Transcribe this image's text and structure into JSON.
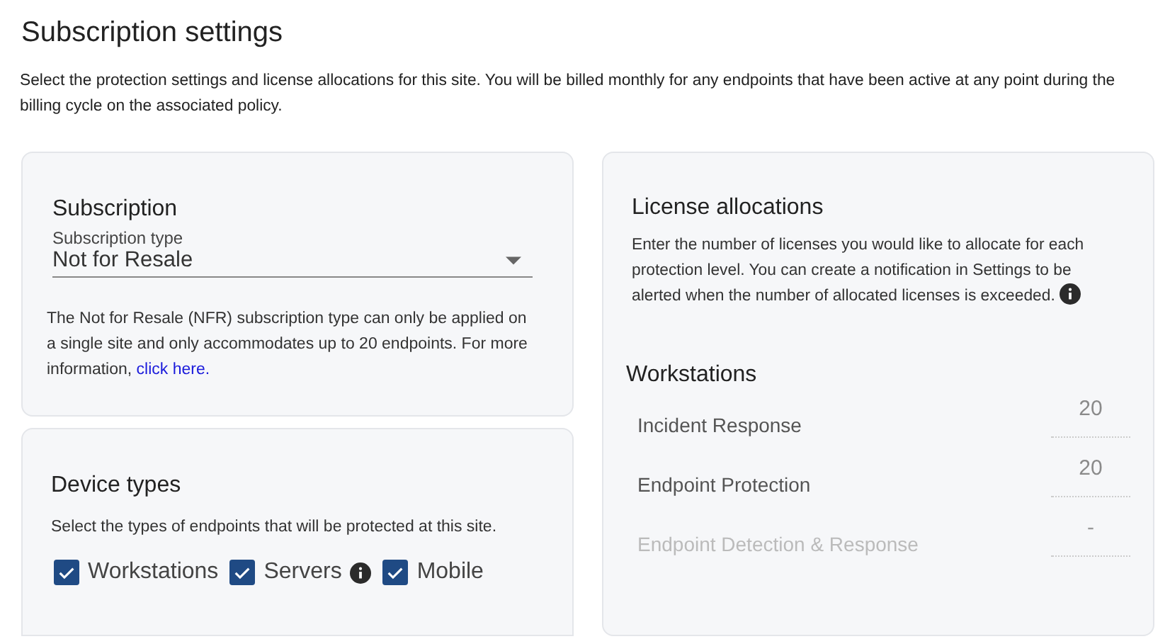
{
  "page": {
    "title": "Subscription settings",
    "description": "Select the protection settings and license allocations for this site. You will be billed monthly for any endpoints that have been active at any point during the billing cycle on the associated policy."
  },
  "subscription": {
    "title": "Subscription",
    "field_label": "Subscription type",
    "value": "Not for Resale",
    "note": "The Not for Resale (NFR) subscription type can only be applied on a single site and only accommodates up to 20 endpoints. For more information, ",
    "link": "click here."
  },
  "device_types": {
    "title": "Device types",
    "description": "Select the types of endpoints that will be protected at this site.",
    "options": [
      {
        "label": "Workstations",
        "checked": true,
        "info": false
      },
      {
        "label": "Servers",
        "checked": true,
        "info": true
      },
      {
        "label": "Mobile",
        "checked": true,
        "info": false
      }
    ]
  },
  "license_allocations": {
    "title": "License allocations",
    "description": "Enter the number of licenses you would like to allocate for each protection level. You can create a notification in Settings to be alerted when the number of allocated licenses is exceeded.",
    "info": true,
    "group": "Workstations",
    "rows": [
      {
        "label": "Incident Response",
        "value": "20",
        "disabled": false
      },
      {
        "label": "Endpoint Protection",
        "value": "20",
        "disabled": false
      },
      {
        "label": "Endpoint Detection & Response",
        "value": "-",
        "disabled": true
      }
    ]
  }
}
